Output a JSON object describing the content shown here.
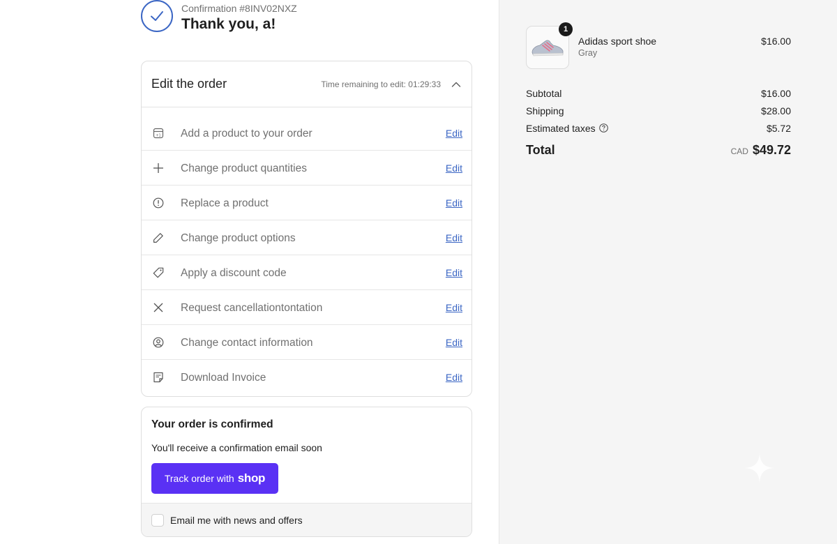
{
  "header": {
    "confirmation": "Confirmation #8INV02NXZ",
    "thank_you": "Thank you, a!"
  },
  "edit_order": {
    "title": "Edit the order",
    "time_remaining": "Time remaining to edit: 01:29:33",
    "edit_label": "Edit",
    "items": [
      {
        "label": "Add a product to your order",
        "icon": "add-product-icon"
      },
      {
        "label": "Change product quantities",
        "icon": "plus-icon"
      },
      {
        "label": "Replace a product",
        "icon": "info-icon"
      },
      {
        "label": "Change product options",
        "icon": "pencil-icon"
      },
      {
        "label": "Apply a discount code",
        "icon": "tag-icon"
      },
      {
        "label": "Request cancellationtontation",
        "icon": "close-icon"
      },
      {
        "label": "Change contact information",
        "icon": "user-circle-icon"
      },
      {
        "label": "Download Invoice",
        "icon": "invoice-icon"
      }
    ]
  },
  "confirmed": {
    "title": "Your order is confirmed",
    "subtitle": "You'll receive a confirmation email soon",
    "track_label": "Track order with",
    "shop_logo": "shop",
    "newsletter_label": "Email me with news and offers"
  },
  "summary": {
    "product": {
      "name": "Adidas sport shoe",
      "variant": "Gray",
      "price": "$16.00",
      "quantity": "1"
    },
    "subtotal_label": "Subtotal",
    "subtotal": "$16.00",
    "shipping_label": "Shipping",
    "shipping": "$28.00",
    "taxes_label": "Estimated taxes",
    "taxes": "$5.72",
    "total_label": "Total",
    "currency": "CAD",
    "total": "$49.72"
  },
  "colors": {
    "accent": "#3b66c4",
    "shop_button": "#5a31f4",
    "sidebar_bg": "#f5f5f5"
  }
}
